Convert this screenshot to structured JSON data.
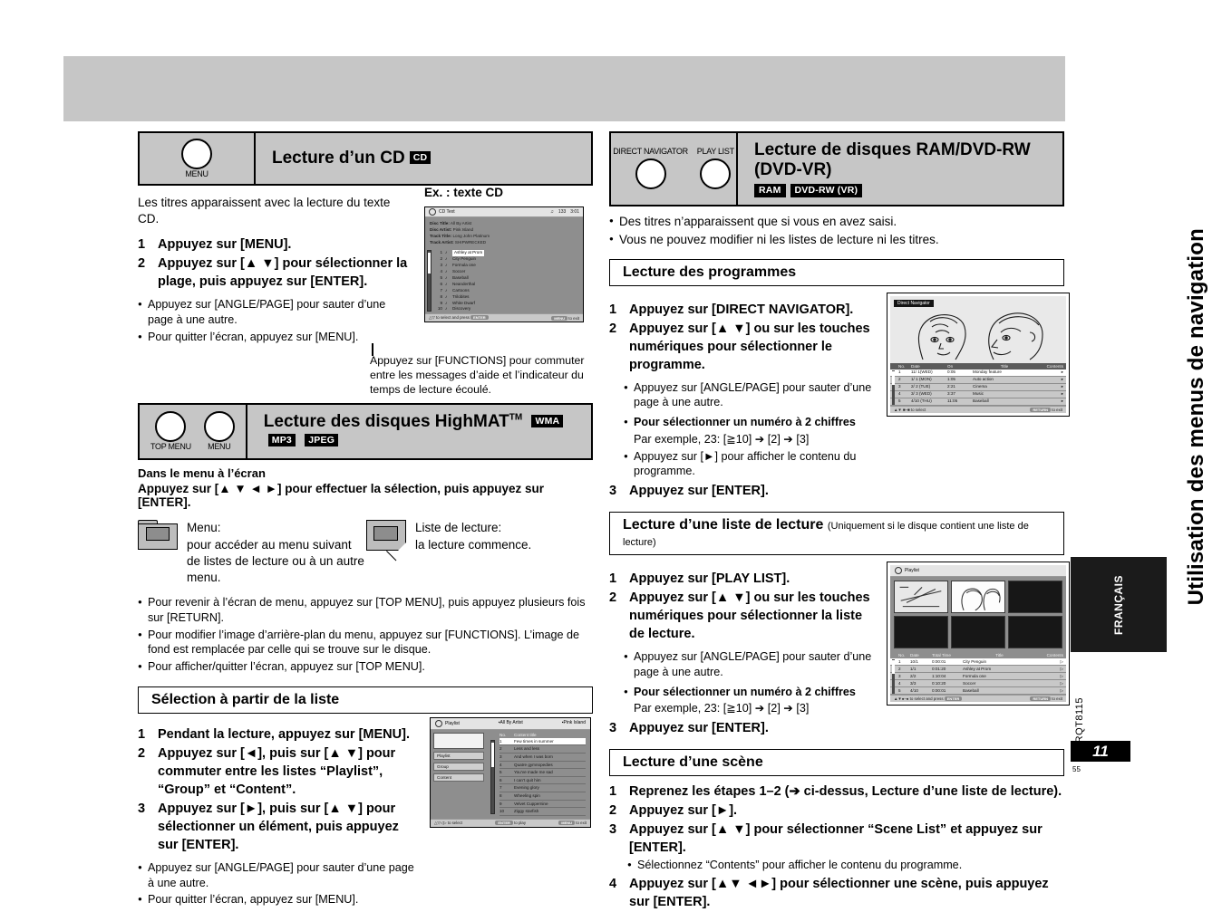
{
  "page": {
    "vertical_title": "Utilisation des menus de navigation",
    "language_tab": "FRANÇAIS",
    "doc_code": "RQT8115",
    "page_number": "11",
    "folio": "55"
  },
  "left": {
    "cd_section": {
      "keys": [
        {
          "label": "MENU"
        }
      ],
      "title": "Lecture d’un CD",
      "disc_tag": "CD",
      "intro": "Les titres apparaissent avec la lecture du texte CD.",
      "steps": [
        {
          "num": "1",
          "text": "Appuyez sur [MENU]."
        },
        {
          "num": "2",
          "text": "Appuyez sur [▲ ▼] pour sélectionner la plage, puis appuyez sur [ENTER]."
        }
      ],
      "bullets": [
        "Appuyez sur [ANGLE/PAGE] pour sauter d’une page à une autre.",
        "Pour quitter l’écran, appuyez sur [MENU]."
      ],
      "figure_caption": "Ex. : texte CD",
      "figure_note": "Appuyez sur [FUNCTIONS] pour commuter entre les messages d’aide et l’indicateur du temps de lecture écoulé."
    },
    "cd_screen": {
      "title": "CD Text",
      "track_count": "133",
      "time": "3:01",
      "info": [
        {
          "label": "Disc Title:",
          "value": "All By Artist"
        },
        {
          "label": "Disc Artist:",
          "value": "Pink Island"
        },
        {
          "label": "Track Title:",
          "value": "Long John Platinum"
        },
        {
          "label": "Track Artist:",
          "value": "SHIPWRECKED"
        }
      ],
      "tracks": [
        {
          "no": "1",
          "title": "Ashley at Prom",
          "selected": true
        },
        {
          "no": "2",
          "title": "City Penguin",
          "selected": false
        },
        {
          "no": "3",
          "title": "Formula one",
          "selected": false
        },
        {
          "no": "4",
          "title": "Soccer",
          "selected": false
        },
        {
          "no": "5",
          "title": "Baseball",
          "selected": false
        },
        {
          "no": "6",
          "title": "Neanderthal",
          "selected": false
        },
        {
          "no": "7",
          "title": "Cartoons",
          "selected": false
        },
        {
          "no": "8",
          "title": "Trilobites",
          "selected": false
        },
        {
          "no": "9",
          "title": "White Dwarf",
          "selected": false
        },
        {
          "no": "10",
          "title": "Discovery",
          "selected": false
        }
      ],
      "footer_left": "to select and press",
      "footer_key": "ENTER",
      "footer_right_key": "MENU",
      "footer_right": "to exit"
    },
    "highmat_section": {
      "keys": [
        {
          "label": "TOP MENU"
        },
        {
          "label": "MENU"
        }
      ],
      "title": "Lecture des disques HighMAT",
      "title_tm": "TM",
      "tags": [
        "WMA",
        "MP3",
        "JPEG"
      ],
      "subhead": "Dans le menu à l’écran",
      "instruction": "Appuyez sur [▲ ▼ ◄ ►] pour effectuer la sélection, puis appuyez sur [ENTER].",
      "icons": [
        {
          "name": "Menu:",
          "desc": "pour accéder au menu suivant de listes de lecture ou à un autre menu."
        },
        {
          "name": "Liste de lecture:",
          "desc": "la lecture commence."
        }
      ],
      "bullets": [
        "Pour revenir à l’écran de menu, appuyez sur [TOP MENU], puis appuyez plusieurs fois sur [RETURN].",
        "Pour modifier l’image d’arrière-plan du menu, appuyez sur [FUNCTIONS]. L’image de fond est remplacée par celle qui se trouve sur le disque.",
        "Pour afficher/quitter l’écran, appuyez sur [TOP MENU]."
      ]
    },
    "selection_section": {
      "heading": "Sélection à partir de la liste",
      "steps": [
        {
          "num": "1",
          "text": "Pendant la lecture, appuyez sur [MENU]."
        },
        {
          "num": "2",
          "text": "Appuyez sur [◄], puis sur [▲ ▼] pour commuter entre les listes “Playlist”, “Group” et “Content”."
        },
        {
          "num": "3",
          "text": "Appuyez sur [►], puis sur [▲ ▼] pour sélectionner un élément, puis appuyez sur [ENTER]."
        }
      ],
      "bullets": [
        "Appuyez sur [ANGLE/PAGE] pour sauter d’une page à une autre.",
        "Pour quitter l’écran, appuyez sur [MENU]."
      ]
    },
    "playlist_screen": {
      "title": "Playlist",
      "header_mid": "All By  Artist",
      "header_right": "Pink Island",
      "tabs": [
        "Playlist",
        "Group",
        "Content"
      ],
      "col_no": "No.",
      "col_title": "Content title",
      "rows": [
        {
          "no": "1",
          "title": "Few times in summer",
          "selected": true
        },
        {
          "no": "2",
          "title": "Less and less",
          "selected": false
        },
        {
          "no": "3",
          "title": "And when I was born",
          "selected": false
        },
        {
          "no": "4",
          "title": "Quatre gymnopedies",
          "selected": false
        },
        {
          "no": "5",
          "title": "You’ve made me sad",
          "selected": false
        },
        {
          "no": "6",
          "title": "I can’t quit him",
          "selected": false
        },
        {
          "no": "7",
          "title": "Evening glory",
          "selected": false
        },
        {
          "no": "8",
          "title": "Wheeling spin",
          "selected": false
        },
        {
          "no": "9",
          "title": "Velvet Cuppernine",
          "selected": false
        },
        {
          "no": "10",
          "title": "Ziggy starfish",
          "selected": false
        }
      ],
      "footer_left": "to select",
      "footer_mid_key": "ENTER",
      "footer_mid": "to play",
      "footer_right_key": "MENU",
      "footer_right": "to exit"
    }
  },
  "right": {
    "ram_section": {
      "keys": [
        {
          "label": "DIRECT NAVIGATOR"
        },
        {
          "label": "PLAY LIST"
        }
      ],
      "title": "Lecture de disques RAM/DVD-RW (DVD-VR)",
      "tags": [
        "RAM",
        "DVD-RW (VR)"
      ],
      "bullets": [
        "Des titres n’apparaissent que si vous en avez saisi.",
        "Vous ne pouvez modifier ni les listes de lecture ni les titres."
      ]
    },
    "programmes_section": {
      "heading": "Lecture des programmes",
      "steps": [
        {
          "num": "1",
          "text": "Appuyez sur [DIRECT NAVIGATOR]."
        },
        {
          "num": "2",
          "text": "Appuyez sur [▲ ▼] ou sur les touches numériques pour sélectionner le programme."
        },
        {
          "num": "3",
          "text": "Appuyez sur [ENTER]."
        }
      ],
      "bullets": [
        "Appuyez sur [ANGLE/PAGE] pour sauter d’une page à une autre."
      ],
      "bold_bullet": "Pour sélectionner un numéro à 2 chiffres",
      "example": "Par exemple, 23: [≧10] ➔ [2] ➔ [3]",
      "last_bullet": "Appuyez sur [►] pour afficher le contenu du programme."
    },
    "direct_navigator_screen": {
      "badge": "Direct Navigator",
      "columns": [
        "No.",
        "Date",
        "On",
        "Title",
        "Contents"
      ],
      "rows": [
        {
          "no": "1",
          "date": "11/ 1(WED)",
          "on": "0:05",
          "title": "Monday feature",
          "selected": true
        },
        {
          "no": "2",
          "date": "1/ 1 (MON)",
          "on": "1:05",
          "title": "Auto action",
          "selected": false
        },
        {
          "no": "3",
          "date": "2/ 2 (TUE)",
          "on": "2:21",
          "title": "Cinema",
          "selected": false
        },
        {
          "no": "4",
          "date": "3/ 3 (WED)",
          "on": "3:37",
          "title": "Music",
          "selected": false
        },
        {
          "no": "5",
          "date": "4/10 (THU)",
          "on": "11:05",
          "title": "Baseball",
          "selected": false
        }
      ],
      "footer_left": "to  select",
      "footer_right_key": "RETURN",
      "footer_right": "to  exit"
    },
    "playlist_section": {
      "heading": "Lecture d’une liste de lecture",
      "heading_note": "(Uniquement si le disque contient une liste de lecture)",
      "steps": [
        {
          "num": "1",
          "text": "Appuyez sur [PLAY LIST]."
        },
        {
          "num": "2",
          "text": "Appuyez sur [▲ ▼] ou sur les touches numériques pour sélectionner la liste de lecture."
        },
        {
          "num": "3",
          "text": "Appuyez sur [ENTER]."
        }
      ],
      "bullets": [
        "Appuyez sur [ANGLE/PAGE] pour sauter d’une page à une autre."
      ],
      "bold_bullet": "Pour sélectionner un numéro à 2 chiffres",
      "example": "Par exemple, 23: [≧10] ➔ [2] ➔ [3]"
    },
    "playlist_vr_screen": {
      "title": "Playlist",
      "columns": [
        "No.",
        "Date",
        "Total Time",
        "Title",
        "Contents"
      ],
      "rows": [
        {
          "no": "1",
          "date": "10/1",
          "total": "0:00:01",
          "title": "City Penguin",
          "selected": true
        },
        {
          "no": "2",
          "date": "1/1",
          "total": "0:01:20",
          "title": "Ashley at Prom",
          "selected": false
        },
        {
          "no": "3",
          "date": "2/2",
          "total": "1:10:04",
          "title": "Formula one",
          "selected": false
        },
        {
          "no": "4",
          "date": "3/3",
          "total": "0:10:20",
          "title": "Soccer",
          "selected": false
        },
        {
          "no": "5",
          "date": "4/10",
          "total": "0:00:01",
          "title": "Baseball",
          "selected": false
        }
      ],
      "footer_left": "to select and press",
      "footer_key": "ENTER",
      "footer_right_key": "RETURN",
      "footer_right": "to exit"
    },
    "scene_section": {
      "heading": "Lecture d’une scène",
      "steps": [
        {
          "num": "1",
          "text": "Reprenez les étapes 1–2 (➔ ci-dessus, Lecture d’une liste de lecture)."
        },
        {
          "num": "2",
          "text": "Appuyez sur [►]."
        },
        {
          "num": "3",
          "text": "Appuyez sur [▲ ▼] pour sélectionner “Scene List” et appuyez sur [ENTER]."
        },
        {
          "num": "4",
          "text": "Appuyez sur [▲▼ ◄►] pour sélectionner une scène, puis appuyez sur [ENTER]."
        }
      ],
      "sub_bullet": "Sélectionnez “Contents” pour afficher le contenu du programme."
    }
  }
}
